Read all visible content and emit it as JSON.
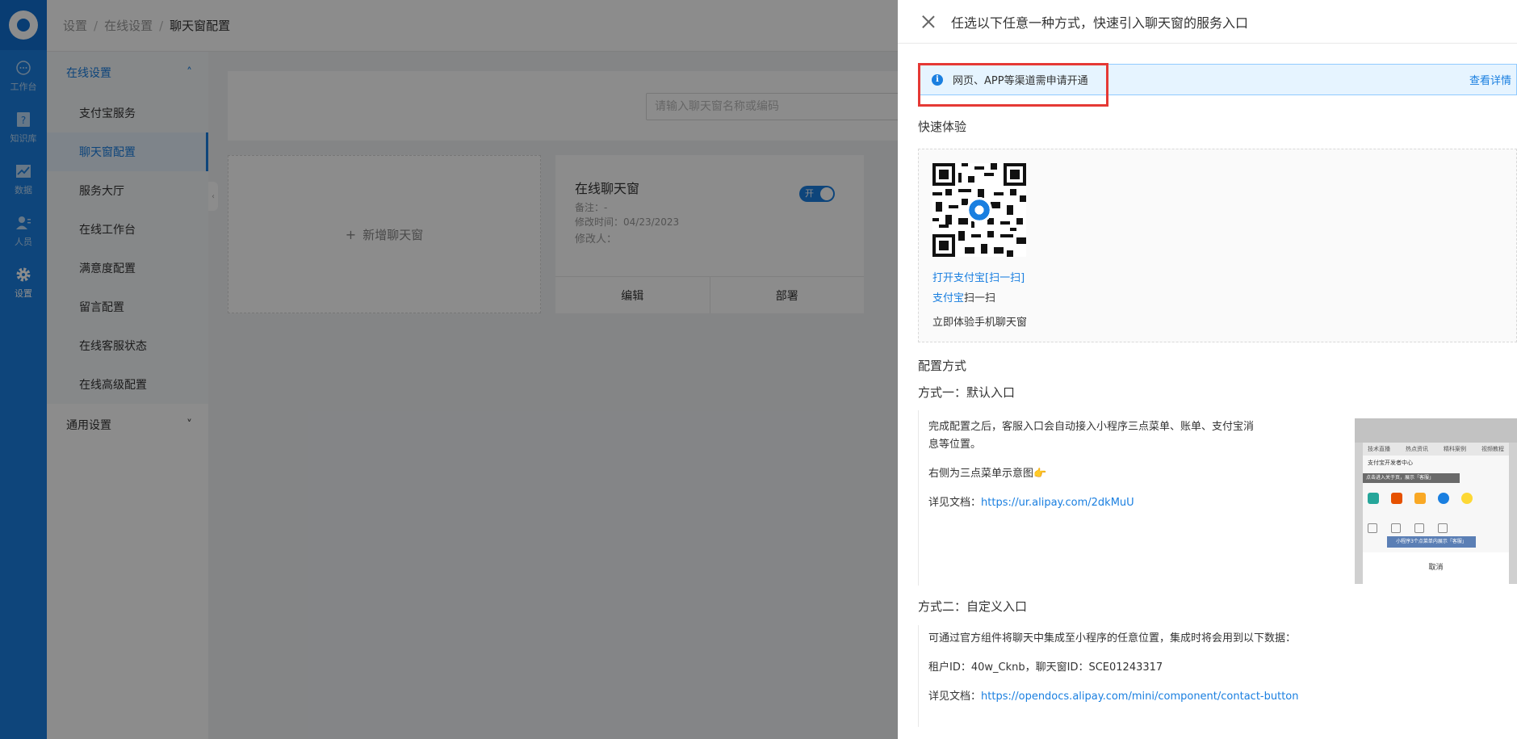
{
  "rail": {
    "items": [
      {
        "label": "工作台",
        "icon": "chat-icon"
      },
      {
        "label": "知识库",
        "icon": "help-book-icon"
      },
      {
        "label": "数据",
        "icon": "chart-icon"
      },
      {
        "label": "人员",
        "icon": "user-icon"
      },
      {
        "label": "设置",
        "icon": "gear-icon"
      }
    ]
  },
  "header": {
    "crumb1": "设置",
    "crumb2": "在线设置",
    "crumb3": "聊天窗配置",
    "sep": "/"
  },
  "submenu": {
    "group1": "在线设置",
    "items": [
      "支付宝服务",
      "聊天窗配置",
      "服务大厅",
      "在线工作台",
      "满意度配置",
      "留言配置",
      "在线客服状态",
      "在线高级配置"
    ],
    "group2": "通用设置"
  },
  "main": {
    "search_placeholder": "请输入聊天窗名称或编码",
    "add_label": "新增聊天窗",
    "card": {
      "title": "在线聊天窗",
      "remark": "备注：-",
      "modified": "修改时间：04/23/2023",
      "modifier": "修改人：",
      "toggle_label": "开",
      "edit": "编辑",
      "deploy": "部署"
    }
  },
  "drawer": {
    "title": "任选以下任意一种方式，快速引入聊天窗的服务入口",
    "notice": "网页、APP等渠道需申请开通",
    "notice_link": "查看详情",
    "quick_title": "快速体验",
    "qr_label1": "打开支付宝[扫一扫]",
    "qr_label2_link": "支付宝",
    "qr_label2_rest": "扫一扫",
    "qr_label3": "立即体验手机聊天窗",
    "config_title": "配置方式",
    "m1_title": "方式一：默认入口",
    "m1_text1": "完成配置之后，客服入口会自动接入小程序三点菜单、账单、支付宝消",
    "m1_text2": "息等位置。",
    "m1_text3": "右侧为三点菜单示意图👉",
    "m1_doc_label": "详见文档：",
    "m1_doc_link": "https://ur.alipay.com/2dkMuU",
    "m2_title": "方式二：自定义入口",
    "m2_text1": "可通过官方组件将聊天中集成至小程序的任意位置，集成时将会用到以下数据：",
    "m2_text2": "租户ID：40w_Cknb，聊天窗ID：SCE01243317",
    "m2_doc_label": "详见文档：",
    "m2_doc_link": "https://opendocs.alipay.com/mini/component/contact-button"
  },
  "preview": {
    "tabs": [
      "技术直播",
      "热点资讯",
      "精科案例",
      "视频教程"
    ],
    "dev_center": "支付宝开发者中心",
    "bar_text": "点击进入关于页，展示「客服」",
    "tip": "小程序3个点菜单内展示「客服」",
    "cancel": "取消"
  },
  "colors": {
    "accent": "#1a7fe0",
    "highlight_box": "#e53935"
  }
}
